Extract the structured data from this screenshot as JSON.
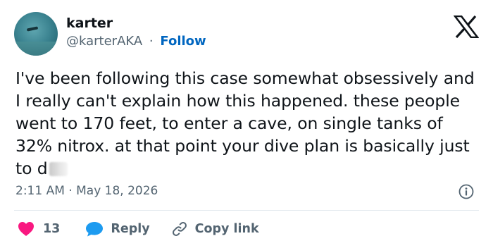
{
  "author": {
    "name": "karter",
    "handle": "@karterAKA",
    "separator": "·",
    "follow_label": "Follow"
  },
  "tweet": {
    "text": "I've been following this case somewhat obsessively and I really can't explain how this happened. these people went to 170 feet, to enter a cave, on single tanks of 32% nitrox. at that point your dive plan is basically just to d"
  },
  "meta": {
    "time": "2:11 AM",
    "separator": "·",
    "date": "May 18, 2026"
  },
  "actions": {
    "like_count": "13",
    "reply_label": "Reply",
    "copy_label": "Copy link"
  },
  "colors": {
    "like": "#f91880",
    "reply": "#1d9bf0",
    "link": "#0066c0",
    "muted": "#536471"
  },
  "icons": [
    "x-logo-icon",
    "info-icon",
    "heart-icon",
    "speech-bubble-icon",
    "link-icon"
  ]
}
